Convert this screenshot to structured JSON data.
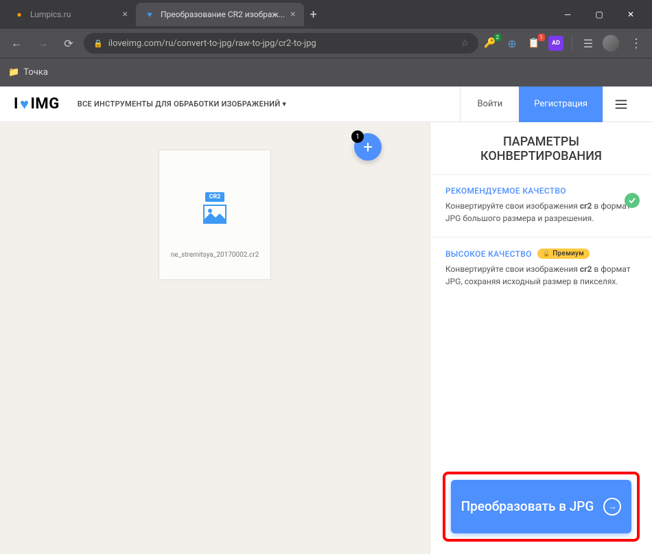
{
  "browser": {
    "tabs": [
      {
        "title": "Lumpics.ru",
        "favicon_color": "#f59e0b"
      },
      {
        "title": "Преобразование CR2 изображ...",
        "favicon_color": "#3d99f5"
      }
    ],
    "url": "iloveimg.com/ru/convert-to-jpg/raw-to-jpg/cr2-to-jpg",
    "bookmarks": [
      {
        "label": "Точка"
      }
    ]
  },
  "header": {
    "logo_left": "I",
    "logo_right": "IMG",
    "tools_label": "ВСЕ ИНСТРУМЕНТЫ ДЛЯ ОБРАБОТКИ ИЗОБРАЖЕНИЙ ▾",
    "login": "Войти",
    "register": "Регистрация"
  },
  "workspace": {
    "file_badge": "CR2",
    "file_name": "ne_stremitsya_20170002.cr2",
    "count": "1"
  },
  "sidebar": {
    "title": "ПАРАМЕТРЫ КОНВЕРТИРОВАНИЯ",
    "quality1": {
      "title": "РЕКОМЕНДУЕМОЕ КАЧЕСТВО",
      "desc_pre": "Конвертируйте свои изображения ",
      "bold": "cr2",
      "desc_post": " в формат JPG большого размера и разрешения."
    },
    "quality2": {
      "title": "ВЫСОКОЕ КАЧЕСТВО",
      "premium": "Премиум",
      "desc_pre": "Конвертируйте свои изображения ",
      "bold": "cr2",
      "desc_post": " в формат JPG, сохраняя исходный размер в пикселях."
    },
    "convert": "Преобразовать в JPG"
  }
}
